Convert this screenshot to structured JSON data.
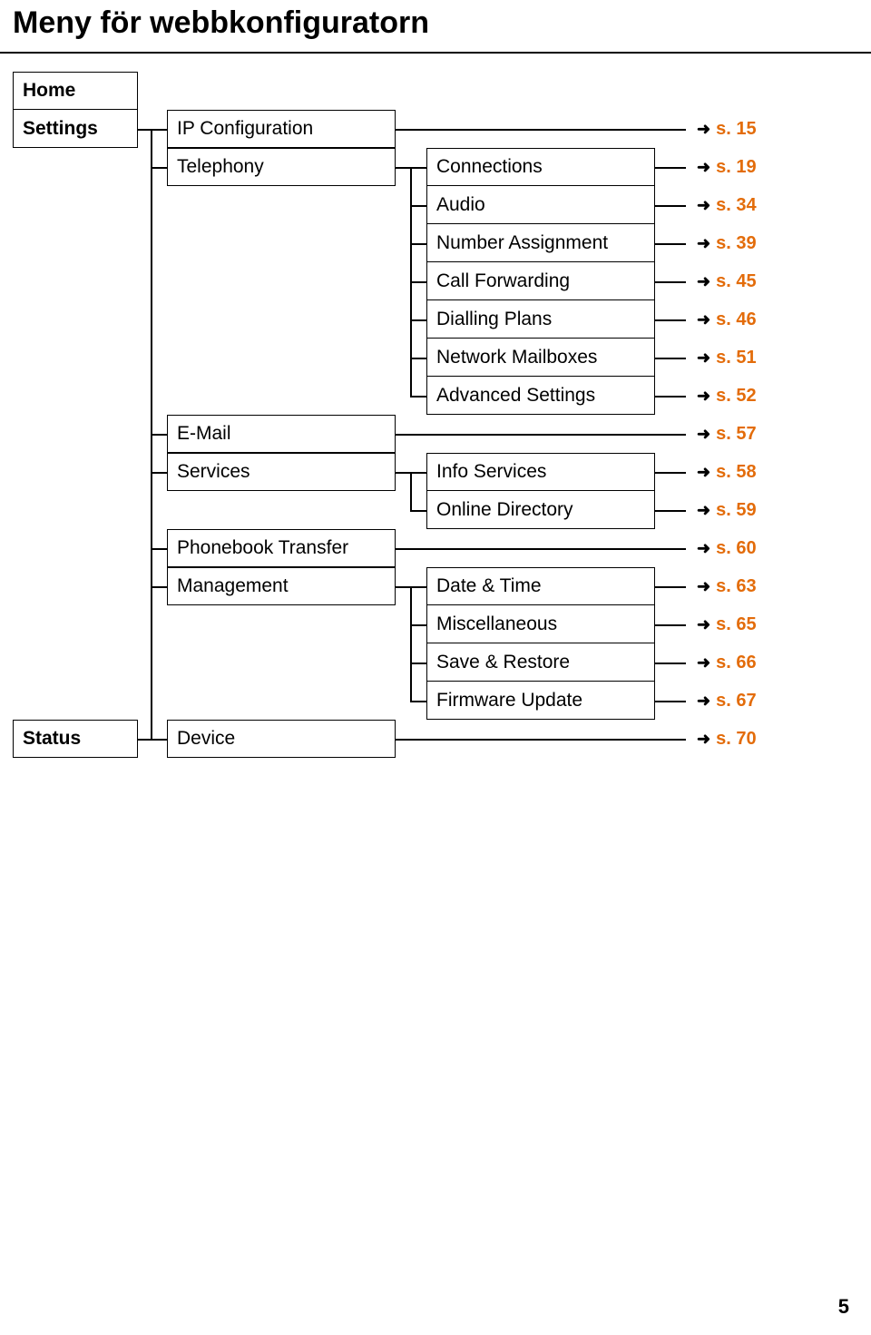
{
  "title": "Meny för webbkonfiguratorn",
  "col1": {
    "home": "Home",
    "settings": "Settings",
    "status": "Status"
  },
  "col2": {
    "ipconfig": "IP Configuration",
    "telephony": "Telephony",
    "email": "E-Mail",
    "services": "Services",
    "phonebook": "Phonebook Transfer",
    "management": "Management",
    "device": "Device"
  },
  "col3": {
    "connections": "Connections",
    "audio": "Audio",
    "numberassign": "Number Assignment",
    "callfwd": "Call Forwarding",
    "dialplans": "Dialling Plans",
    "netmail": "Network Mailboxes",
    "advsettings": "Advanced Settings",
    "infoservices": "Info Services",
    "onlinedir": "Online Directory",
    "datetime": "Date & Time",
    "misc": "Miscellaneous",
    "saverestore": "Save & Restore",
    "fwupdate": "Firmware Update"
  },
  "refs": {
    "r15": "s. 15",
    "r19": "s. 19",
    "r34": "s. 34",
    "r39": "s. 39",
    "r45": "s. 45",
    "r46": "s. 46",
    "r51": "s. 51",
    "r52": "s. 52",
    "r57": "s. 57",
    "r58": "s. 58",
    "r59": "s. 59",
    "r60": "s. 60",
    "r63": "s. 63",
    "r65": "s. 65",
    "r66": "s. 66",
    "r67": "s. 67",
    "r70": "s. 70"
  },
  "pageNumber": "5"
}
